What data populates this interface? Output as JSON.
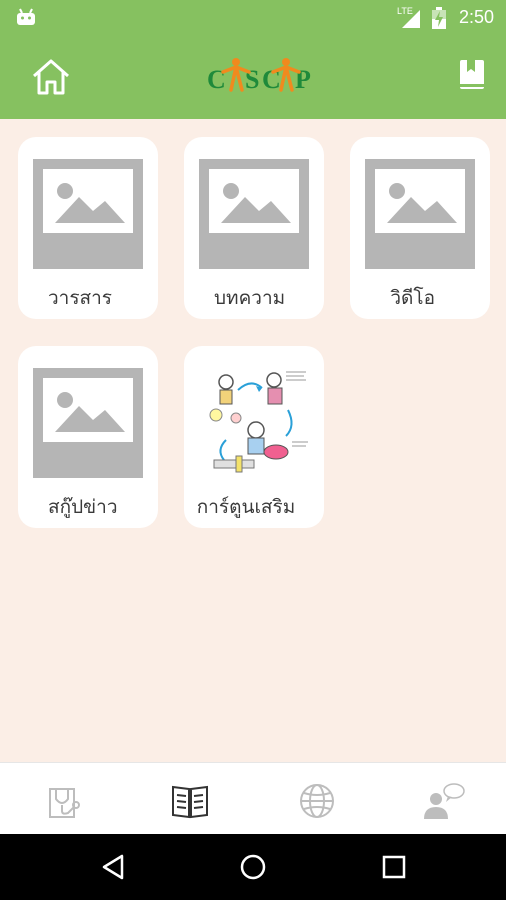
{
  "status_bar": {
    "network_label": "LTE",
    "time": "2:50"
  },
  "app_bar": {
    "logo_text": "CASCAP"
  },
  "categories": [
    {
      "label": "วารสาร",
      "image": "placeholder-image-icon"
    },
    {
      "label": "บทความ",
      "image": "placeholder-image-icon"
    },
    {
      "label": "วิดีโอ",
      "image": "placeholder-image-icon"
    },
    {
      "label": "สกู๊ปข่าว",
      "image": "placeholder-image-icon"
    },
    {
      "label": "การ์ตูนเสริม",
      "image": "cartoon-illustration"
    }
  ],
  "bottom_nav": {
    "items": [
      "stethoscope-icon",
      "open-book-icon",
      "globe-icon",
      "doctor-chat-icon"
    ],
    "active": "open-book-icon"
  },
  "colors": {
    "primary_green": "#86c160",
    "background": "#fbeee6",
    "card": "#ffffff",
    "placeholder": "#b5b5b5",
    "logo_green": "#1f8a3a",
    "logo_orange": "#f08a1e"
  }
}
